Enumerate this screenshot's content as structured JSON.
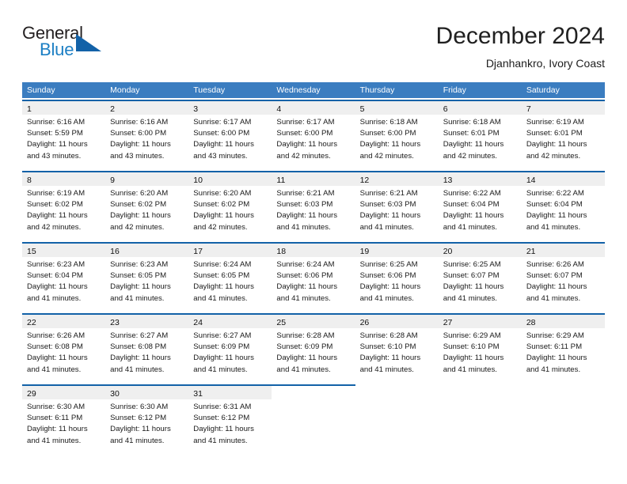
{
  "brand": {
    "name_part1": "General",
    "name_part2": "Blue",
    "triangle_color": "#1362a8",
    "blue_color": "#1c7fc4"
  },
  "header": {
    "title": "December 2024",
    "subtitle": "Djanhankro, Ivory Coast"
  },
  "theme": {
    "header_row_bg": "#3b7dc0",
    "cell_top_border": "#1362a8",
    "daynum_band_bg": "#efefef"
  },
  "calendar": {
    "weekday_headers": [
      "Sunday",
      "Monday",
      "Tuesday",
      "Wednesday",
      "Thursday",
      "Friday",
      "Saturday"
    ],
    "weeks": [
      [
        {
          "day": "1",
          "sunrise": "Sunrise: 6:16 AM",
          "sunset": "Sunset: 5:59 PM",
          "daylight1": "Daylight: 11 hours",
          "daylight2": "and 43 minutes."
        },
        {
          "day": "2",
          "sunrise": "Sunrise: 6:16 AM",
          "sunset": "Sunset: 6:00 PM",
          "daylight1": "Daylight: 11 hours",
          "daylight2": "and 43 minutes."
        },
        {
          "day": "3",
          "sunrise": "Sunrise: 6:17 AM",
          "sunset": "Sunset: 6:00 PM",
          "daylight1": "Daylight: 11 hours",
          "daylight2": "and 43 minutes."
        },
        {
          "day": "4",
          "sunrise": "Sunrise: 6:17 AM",
          "sunset": "Sunset: 6:00 PM",
          "daylight1": "Daylight: 11 hours",
          "daylight2": "and 42 minutes."
        },
        {
          "day": "5",
          "sunrise": "Sunrise: 6:18 AM",
          "sunset": "Sunset: 6:00 PM",
          "daylight1": "Daylight: 11 hours",
          "daylight2": "and 42 minutes."
        },
        {
          "day": "6",
          "sunrise": "Sunrise: 6:18 AM",
          "sunset": "Sunset: 6:01 PM",
          "daylight1": "Daylight: 11 hours",
          "daylight2": "and 42 minutes."
        },
        {
          "day": "7",
          "sunrise": "Sunrise: 6:19 AM",
          "sunset": "Sunset: 6:01 PM",
          "daylight1": "Daylight: 11 hours",
          "daylight2": "and 42 minutes."
        }
      ],
      [
        {
          "day": "8",
          "sunrise": "Sunrise: 6:19 AM",
          "sunset": "Sunset: 6:02 PM",
          "daylight1": "Daylight: 11 hours",
          "daylight2": "and 42 minutes."
        },
        {
          "day": "9",
          "sunrise": "Sunrise: 6:20 AM",
          "sunset": "Sunset: 6:02 PM",
          "daylight1": "Daylight: 11 hours",
          "daylight2": "and 42 minutes."
        },
        {
          "day": "10",
          "sunrise": "Sunrise: 6:20 AM",
          "sunset": "Sunset: 6:02 PM",
          "daylight1": "Daylight: 11 hours",
          "daylight2": "and 42 minutes."
        },
        {
          "day": "11",
          "sunrise": "Sunrise: 6:21 AM",
          "sunset": "Sunset: 6:03 PM",
          "daylight1": "Daylight: 11 hours",
          "daylight2": "and 41 minutes."
        },
        {
          "day": "12",
          "sunrise": "Sunrise: 6:21 AM",
          "sunset": "Sunset: 6:03 PM",
          "daylight1": "Daylight: 11 hours",
          "daylight2": "and 41 minutes."
        },
        {
          "day": "13",
          "sunrise": "Sunrise: 6:22 AM",
          "sunset": "Sunset: 6:04 PM",
          "daylight1": "Daylight: 11 hours",
          "daylight2": "and 41 minutes."
        },
        {
          "day": "14",
          "sunrise": "Sunrise: 6:22 AM",
          "sunset": "Sunset: 6:04 PM",
          "daylight1": "Daylight: 11 hours",
          "daylight2": "and 41 minutes."
        }
      ],
      [
        {
          "day": "15",
          "sunrise": "Sunrise: 6:23 AM",
          "sunset": "Sunset: 6:04 PM",
          "daylight1": "Daylight: 11 hours",
          "daylight2": "and 41 minutes."
        },
        {
          "day": "16",
          "sunrise": "Sunrise: 6:23 AM",
          "sunset": "Sunset: 6:05 PM",
          "daylight1": "Daylight: 11 hours",
          "daylight2": "and 41 minutes."
        },
        {
          "day": "17",
          "sunrise": "Sunrise: 6:24 AM",
          "sunset": "Sunset: 6:05 PM",
          "daylight1": "Daylight: 11 hours",
          "daylight2": "and 41 minutes."
        },
        {
          "day": "18",
          "sunrise": "Sunrise: 6:24 AM",
          "sunset": "Sunset: 6:06 PM",
          "daylight1": "Daylight: 11 hours",
          "daylight2": "and 41 minutes."
        },
        {
          "day": "19",
          "sunrise": "Sunrise: 6:25 AM",
          "sunset": "Sunset: 6:06 PM",
          "daylight1": "Daylight: 11 hours",
          "daylight2": "and 41 minutes."
        },
        {
          "day": "20",
          "sunrise": "Sunrise: 6:25 AM",
          "sunset": "Sunset: 6:07 PM",
          "daylight1": "Daylight: 11 hours",
          "daylight2": "and 41 minutes."
        },
        {
          "day": "21",
          "sunrise": "Sunrise: 6:26 AM",
          "sunset": "Sunset: 6:07 PM",
          "daylight1": "Daylight: 11 hours",
          "daylight2": "and 41 minutes."
        }
      ],
      [
        {
          "day": "22",
          "sunrise": "Sunrise: 6:26 AM",
          "sunset": "Sunset: 6:08 PM",
          "daylight1": "Daylight: 11 hours",
          "daylight2": "and 41 minutes."
        },
        {
          "day": "23",
          "sunrise": "Sunrise: 6:27 AM",
          "sunset": "Sunset: 6:08 PM",
          "daylight1": "Daylight: 11 hours",
          "daylight2": "and 41 minutes."
        },
        {
          "day": "24",
          "sunrise": "Sunrise: 6:27 AM",
          "sunset": "Sunset: 6:09 PM",
          "daylight1": "Daylight: 11 hours",
          "daylight2": "and 41 minutes."
        },
        {
          "day": "25",
          "sunrise": "Sunrise: 6:28 AM",
          "sunset": "Sunset: 6:09 PM",
          "daylight1": "Daylight: 11 hours",
          "daylight2": "and 41 minutes."
        },
        {
          "day": "26",
          "sunrise": "Sunrise: 6:28 AM",
          "sunset": "Sunset: 6:10 PM",
          "daylight1": "Daylight: 11 hours",
          "daylight2": "and 41 minutes."
        },
        {
          "day": "27",
          "sunrise": "Sunrise: 6:29 AM",
          "sunset": "Sunset: 6:10 PM",
          "daylight1": "Daylight: 11 hours",
          "daylight2": "and 41 minutes."
        },
        {
          "day": "28",
          "sunrise": "Sunrise: 6:29 AM",
          "sunset": "Sunset: 6:11 PM",
          "daylight1": "Daylight: 11 hours",
          "daylight2": "and 41 minutes."
        }
      ],
      [
        {
          "day": "29",
          "sunrise": "Sunrise: 6:30 AM",
          "sunset": "Sunset: 6:11 PM",
          "daylight1": "Daylight: 11 hours",
          "daylight2": "and 41 minutes."
        },
        {
          "day": "30",
          "sunrise": "Sunrise: 6:30 AM",
          "sunset": "Sunset: 6:12 PM",
          "daylight1": "Daylight: 11 hours",
          "daylight2": "and 41 minutes."
        },
        {
          "day": "31",
          "sunrise": "Sunrise: 6:31 AM",
          "sunset": "Sunset: 6:12 PM",
          "daylight1": "Daylight: 11 hours",
          "daylight2": "and 41 minutes."
        },
        {
          "day": "",
          "sunrise": "",
          "sunset": "",
          "daylight1": "",
          "daylight2": ""
        },
        {
          "day": "",
          "sunrise": "",
          "sunset": "",
          "daylight1": "",
          "daylight2": ""
        },
        {
          "day": "",
          "sunrise": "",
          "sunset": "",
          "daylight1": "",
          "daylight2": ""
        },
        {
          "day": "",
          "sunrise": "",
          "sunset": "",
          "daylight1": "",
          "daylight2": ""
        }
      ]
    ]
  }
}
